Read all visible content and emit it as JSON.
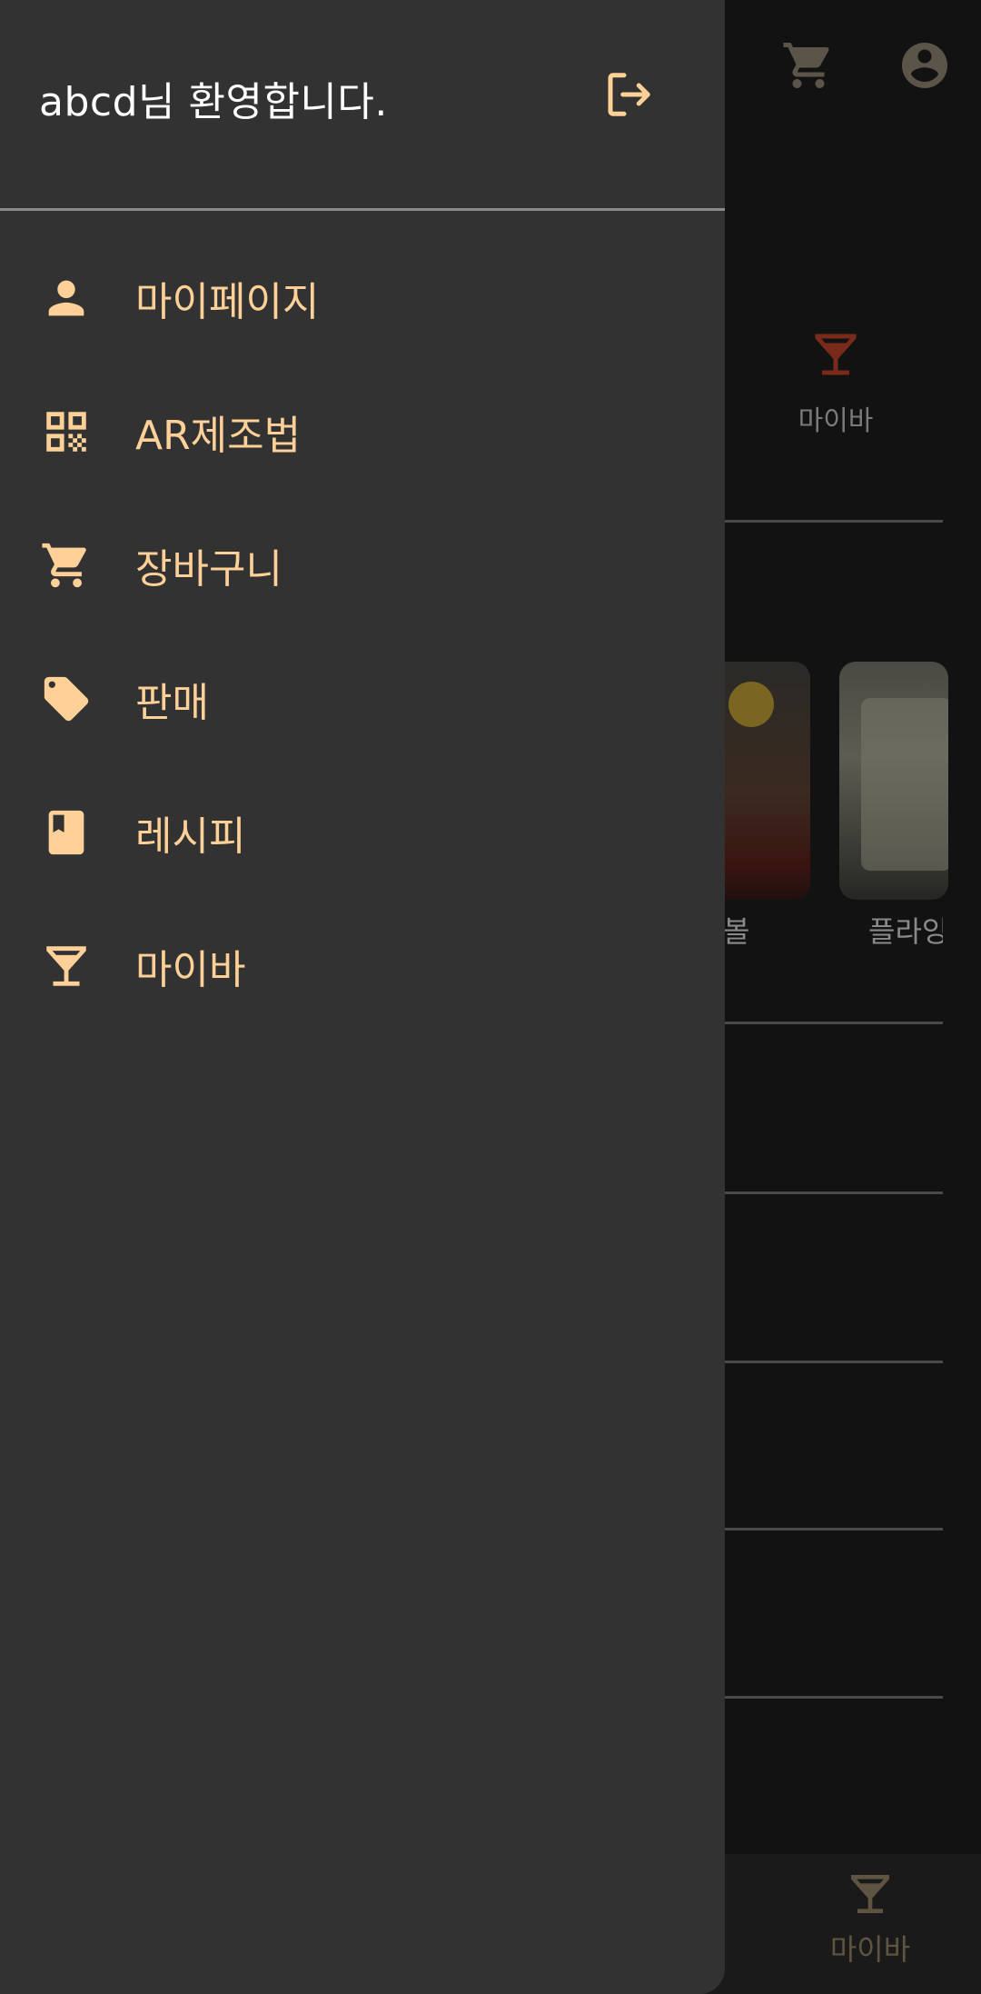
{
  "drawer": {
    "welcome_text": "abcd님 환영합니다.",
    "logout_icon": "logout-icon",
    "items": [
      {
        "label": "마이페이지",
        "icon": "person-icon"
      },
      {
        "label": "AR제조법",
        "icon": "qr-code-icon"
      },
      {
        "label": "장바구니",
        "icon": "cart-icon"
      },
      {
        "label": "판매",
        "icon": "tag-icon"
      },
      {
        "label": "레시피",
        "icon": "book-icon"
      },
      {
        "label": "마이바",
        "icon": "cocktail-icon"
      }
    ]
  },
  "background": {
    "category_label": "마이바",
    "card_labels": [
      "볼",
      "플라잉"
    ],
    "bottom_nav_label": "마이바"
  },
  "colors": {
    "drawer_bg": "#323232",
    "accent": "#ffd198",
    "scrim": "#121212"
  }
}
